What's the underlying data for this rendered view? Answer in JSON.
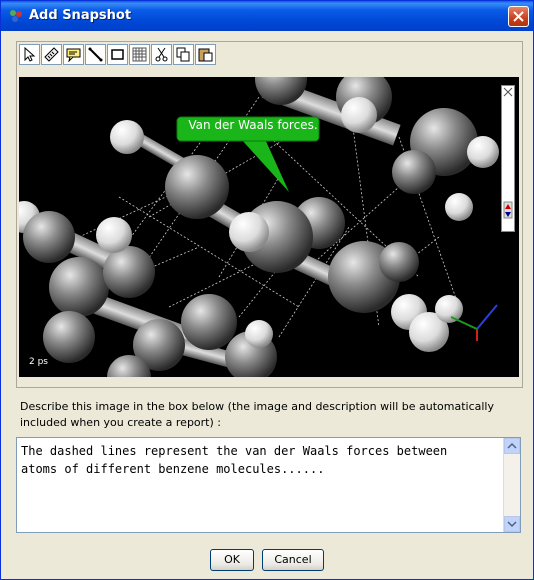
{
  "window": {
    "title": "Add Snapshot"
  },
  "toolbar": {
    "tools": [
      {
        "name": "select-arrow-icon"
      },
      {
        "name": "measure-ruler-icon"
      },
      {
        "name": "callout-icon"
      },
      {
        "name": "line-icon"
      },
      {
        "name": "rectangle-icon"
      },
      {
        "name": "grid-icon"
      },
      {
        "name": "cut-icon"
      },
      {
        "name": "copy-icon"
      },
      {
        "name": "paste-icon"
      }
    ]
  },
  "snapshot": {
    "callout_text": "Van der Waals forces.",
    "time_label": "2 ps"
  },
  "description": {
    "prompt": "Describe this image in the box below (the image and description will be automatically included when you create a report) :",
    "text": "The dashed lines represent the van der Waals forces between\natoms of different benzene molecules......"
  },
  "buttons": {
    "ok": "OK",
    "cancel": "Cancel"
  },
  "colors": {
    "titlebar": "#0a5ce8",
    "callout": "#19b519",
    "background": "#ece9d8"
  }
}
